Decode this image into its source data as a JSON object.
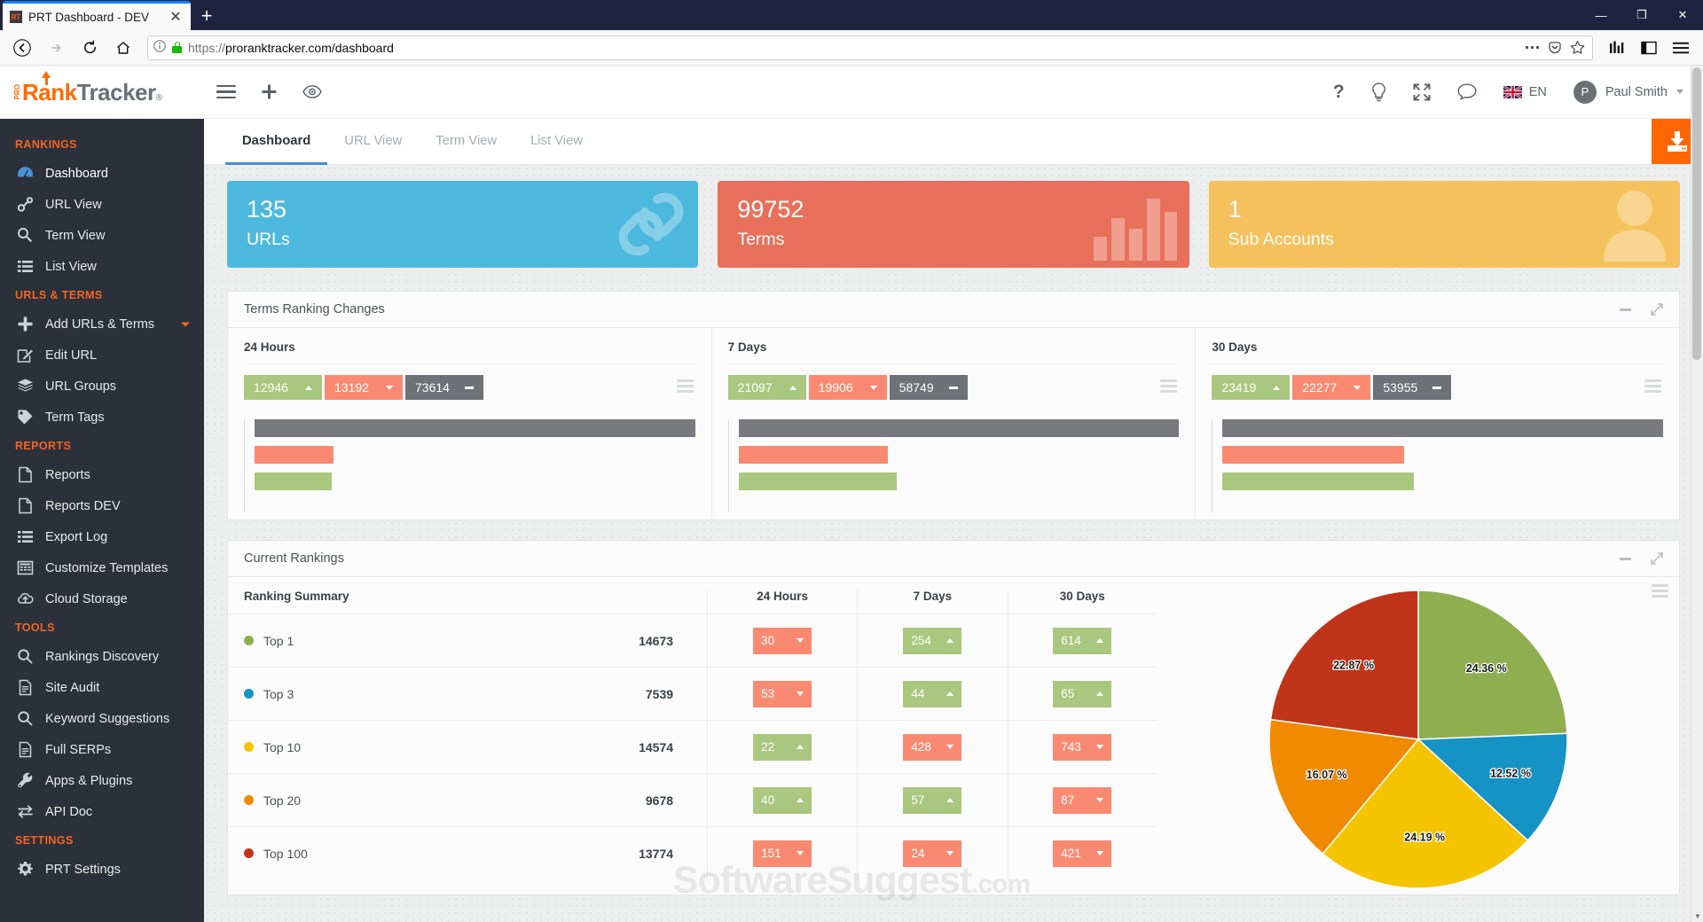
{
  "browser": {
    "tab_title": "PRT Dashboard - DEV",
    "tab_favicon_text": "RT",
    "close_tab_glyph": "✕",
    "new_tab_glyph": "+",
    "url_scheme": "https://",
    "url_host_path": "proranktracker.com/dashboard",
    "url_full": "https://proranktracker.com/dashboard",
    "win_minimize": "—",
    "win_maximize": "❐",
    "win_close": "✕"
  },
  "app": {
    "logo": {
      "pro": "PRO",
      "rank": "Rank",
      "tracker": "Tracker",
      "reg": "®"
    },
    "topbar": {
      "lang": "EN",
      "avatar_initial": "P",
      "user_name": "Paul Smith",
      "help_glyph": "?"
    },
    "tabs": [
      {
        "label": "Dashboard",
        "active": true
      },
      {
        "label": "URL View",
        "active": false
      },
      {
        "label": "Term View",
        "active": false
      },
      {
        "label": "List View",
        "active": false
      }
    ]
  },
  "sidebar": {
    "groups": [
      {
        "heading": "RANKINGS",
        "items": [
          {
            "label": "Dashboard",
            "icon": "gauge-icon",
            "active": true
          },
          {
            "label": "URL View",
            "icon": "link-icon",
            "active": false
          },
          {
            "label": "Term View",
            "icon": "key-icon",
            "active": false
          },
          {
            "label": "List View",
            "icon": "list-icon",
            "active": false
          }
        ]
      },
      {
        "heading": "URLS & TERMS",
        "items": [
          {
            "label": "Add URLs & Terms",
            "icon": "plus-icon",
            "caret": true
          },
          {
            "label": "Edit URL",
            "icon": "edit-icon"
          },
          {
            "label": "URL Groups",
            "icon": "layers-icon"
          },
          {
            "label": "Term Tags",
            "icon": "tag-icon"
          }
        ]
      },
      {
        "heading": "REPORTS",
        "items": [
          {
            "label": "Reports",
            "icon": "file-icon"
          },
          {
            "label": "Reports DEV",
            "icon": "file-icon"
          },
          {
            "label": "Export Log",
            "icon": "list-icon"
          },
          {
            "label": "Customize Templates",
            "icon": "template-icon"
          },
          {
            "label": "Cloud Storage",
            "icon": "cloud-upload-icon"
          }
        ]
      },
      {
        "heading": "TOOLS",
        "items": [
          {
            "label": "Rankings Discovery",
            "icon": "search-icon"
          },
          {
            "label": "Site Audit",
            "icon": "document-icon"
          },
          {
            "label": "Keyword Suggestions",
            "icon": "search-icon"
          },
          {
            "label": "Full SERPs",
            "icon": "document-icon"
          },
          {
            "label": "Apps & Plugins",
            "icon": "wrench-icon"
          },
          {
            "label": "API Doc",
            "icon": "exchange-icon"
          }
        ]
      },
      {
        "heading": "SETTINGS",
        "items": [
          {
            "label": "PRT Settings",
            "icon": "gear-icon"
          }
        ]
      }
    ]
  },
  "stats": [
    {
      "value": "135",
      "label": "URLs",
      "color": "#4db8dd",
      "art": "chain-icon"
    },
    {
      "value": "99752",
      "label": "Terms",
      "color": "#e8705a",
      "art": "bars-icon"
    },
    {
      "value": "1",
      "label": "Sub Accounts",
      "color": "#f5c15c",
      "art": "user-icon"
    }
  ],
  "terms_ranking_changes": {
    "title": "Terms Ranking Changes",
    "panels": [
      {
        "heading": "24 Hours",
        "pills": [
          {
            "value": "12946",
            "dir": "up"
          },
          {
            "value": "13192",
            "dir": "down"
          },
          {
            "value": "73614",
            "dir": "flat"
          }
        ]
      },
      {
        "heading": "7 Days",
        "pills": [
          {
            "value": "21097",
            "dir": "up"
          },
          {
            "value": "19906",
            "dir": "down"
          },
          {
            "value": "58749",
            "dir": "flat"
          }
        ]
      },
      {
        "heading": "30 Days",
        "pills": [
          {
            "value": "23419",
            "dir": "up"
          },
          {
            "value": "22277",
            "dir": "down"
          },
          {
            "value": "53955",
            "dir": "flat"
          }
        ]
      }
    ]
  },
  "current_rankings": {
    "title": "Current Rankings",
    "columns": [
      "Ranking Summary",
      "",
      "24 Hours",
      "7 Days",
      "30 Days"
    ],
    "rows": [
      {
        "name": "Top 1",
        "dot": "#8fae4f",
        "count": "14673",
        "h24": {
          "v": "30",
          "dir": "down"
        },
        "d7": {
          "v": "254",
          "dir": "up"
        },
        "d30": {
          "v": "614",
          "dir": "up"
        }
      },
      {
        "name": "Top 3",
        "dot": "#1593c4",
        "count": "7539",
        "h24": {
          "v": "53",
          "dir": "down"
        },
        "d7": {
          "v": "44",
          "dir": "up"
        },
        "d30": {
          "v": "65",
          "dir": "up"
        }
      },
      {
        "name": "Top 10",
        "dot": "#f5c400",
        "count": "14574",
        "h24": {
          "v": "22",
          "dir": "up"
        },
        "d7": {
          "v": "428",
          "dir": "down"
        },
        "d30": {
          "v": "743",
          "dir": "down"
        }
      },
      {
        "name": "Top 20",
        "dot": "#f08a00",
        "count": "9678",
        "h24": {
          "v": "40",
          "dir": "up"
        },
        "d7": {
          "v": "57",
          "dir": "up"
        },
        "d30": {
          "v": "87",
          "dir": "down"
        }
      },
      {
        "name": "Top 100",
        "dot": "#c0341a",
        "count": "13774",
        "h24": {
          "v": "151",
          "dir": "down"
        },
        "d7": {
          "v": "24",
          "dir": "down"
        },
        "d30": {
          "v": "421",
          "dir": "down"
        }
      }
    ]
  },
  "watermark": {
    "main": "SoftwareSuggest",
    "suffix": ".com"
  },
  "chart_data": [
    {
      "type": "bar",
      "title": "24 Hours",
      "categories": [
        "No Change",
        "Down",
        "Up"
      ],
      "values": [
        73614,
        13192,
        12946
      ],
      "colors": [
        "#77797c",
        "#f98a71",
        "#a9c77e"
      ],
      "orientation": "horizontal",
      "xlabel": "",
      "ylabel": "",
      "grid": false,
      "legend": "none"
    },
    {
      "type": "bar",
      "title": "7 Days",
      "categories": [
        "No Change",
        "Down",
        "Up"
      ],
      "values": [
        58749,
        19906,
        21097
      ],
      "colors": [
        "#77797c",
        "#f98a71",
        "#a9c77e"
      ],
      "orientation": "horizontal",
      "xlabel": "",
      "ylabel": "",
      "grid": false,
      "legend": "none"
    },
    {
      "type": "bar",
      "title": "30 Days",
      "categories": [
        "No Change",
        "Down",
        "Up"
      ],
      "values": [
        53955,
        22277,
        23419
      ],
      "colors": [
        "#77797c",
        "#f98a71",
        "#a9c77e"
      ],
      "orientation": "horizontal",
      "xlabel": "",
      "ylabel": "",
      "grid": false,
      "legend": "none"
    },
    {
      "type": "pie",
      "title": "Current Rankings Distribution",
      "labels": [
        "Top 1",
        "Top 3",
        "Top 10",
        "Top 20",
        "Top 100"
      ],
      "values": [
        24.36,
        12.52,
        24.19,
        16.07,
        22.87
      ],
      "display_labels": [
        "24.36 %",
        "12.52 %",
        "24.19 %",
        "16.07 %",
        "22.87 %"
      ],
      "counts": [
        14673,
        7539,
        14574,
        9678,
        13774
      ],
      "colors": [
        "#8fae4f",
        "#1593c4",
        "#f5c400",
        "#f08a00",
        "#c0341a"
      ],
      "start_angle_deg": 0,
      "direction": "clockwise",
      "legend": "none"
    }
  ]
}
